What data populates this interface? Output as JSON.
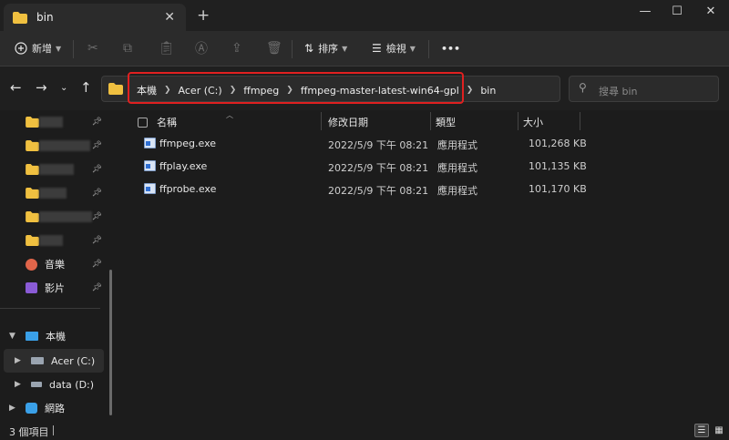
{
  "window": {
    "tab_title": "bin",
    "tab_close": "✕",
    "new_tab": "+",
    "minimize": "—",
    "maximize": "☐",
    "close": "✕"
  },
  "toolbar": {
    "new_label": "新增",
    "sort_label": "排序",
    "view_label": "檢視",
    "more_label": "•••"
  },
  "address": {
    "breadcrumbs": [
      "本機",
      "Acer (C:)",
      "ffmpeg",
      "ffmpeg-master-latest-win64-gpl",
      "bin"
    ],
    "search_placeholder": "搜尋 bin"
  },
  "sidebar": {
    "music": "音樂",
    "videos": "影片",
    "this_pc": "本機",
    "drive_c": "Acer (C:)",
    "drive_d": "data (D:)",
    "network": "網路"
  },
  "columns": {
    "name": "名稱",
    "modified": "修改日期",
    "type": "類型",
    "size": "大小"
  },
  "files": [
    {
      "name": "ffmpeg.exe",
      "modified": "2022/5/9 下午 08:21",
      "type": "應用程式",
      "size": "101,268 KB"
    },
    {
      "name": "ffplay.exe",
      "modified": "2022/5/9 下午 08:21",
      "type": "應用程式",
      "size": "101,135 KB"
    },
    {
      "name": "ffprobe.exe",
      "modified": "2022/5/9 下午 08:21",
      "type": "應用程式",
      "size": "101,170 KB"
    }
  ],
  "status": {
    "item_count": "3 個項目"
  },
  "colors": {
    "highlight_box": "#e02020",
    "folder_yellow": "#f0c040"
  }
}
